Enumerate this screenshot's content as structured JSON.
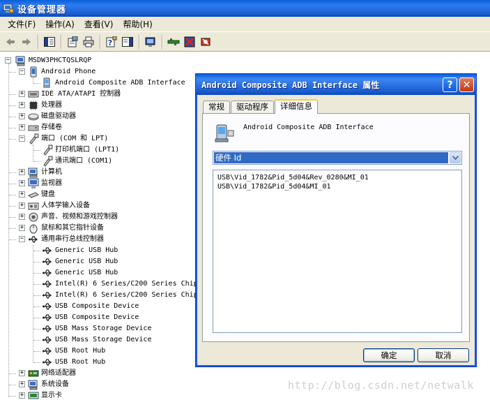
{
  "window": {
    "title": "设备管理器"
  },
  "menu": [
    {
      "label": "文件(F)"
    },
    {
      "label": "操作(A)"
    },
    {
      "label": "查看(V)"
    },
    {
      "label": "帮助(H)"
    }
  ],
  "toolbar": {
    "icons": [
      "back-icon",
      "forward-icon",
      "show-hide-console-tree-icon",
      "properties-icon",
      "print-icon",
      "help-icon",
      "action-pane-icon",
      "scan-hardware-icon",
      "update-driver-icon",
      "disable-device-icon",
      "uninstall-device-icon"
    ]
  },
  "tree": {
    "root": "MSDW3PHCTQSLRQP",
    "nodes": [
      {
        "label": "Android Phone",
        "icon": "phone-icon",
        "level": 1,
        "expander": "-"
      },
      {
        "label": "Android Composite ADB Interface",
        "icon": "usb-device-icon",
        "level": 2,
        "expander": ""
      },
      {
        "label": "IDE ATA/ATAPI 控制器",
        "icon": "ide-controller-icon",
        "level": 1,
        "expander": "+"
      },
      {
        "label": "处理器",
        "icon": "processor-icon",
        "level": 1,
        "expander": "+"
      },
      {
        "label": "磁盘驱动器",
        "icon": "disk-drive-icon",
        "level": 1,
        "expander": "+"
      },
      {
        "label": "存储卷",
        "icon": "storage-volume-icon",
        "level": 1,
        "expander": "+"
      },
      {
        "label": "端口 (COM 和 LPT)",
        "icon": "port-icon",
        "level": 1,
        "expander": "-"
      },
      {
        "label": "打印机端口 (LPT1)",
        "icon": "port-icon",
        "level": 2,
        "expander": ""
      },
      {
        "label": "通讯端口 (COM1)",
        "icon": "port-icon",
        "level": 2,
        "expander": ""
      },
      {
        "label": "计算机",
        "icon": "computer-icon",
        "level": 1,
        "expander": "+"
      },
      {
        "label": "监视器",
        "icon": "monitor-icon",
        "level": 1,
        "expander": "+"
      },
      {
        "label": "键盘",
        "icon": "keyboard-icon",
        "level": 1,
        "expander": "+"
      },
      {
        "label": "人体学输入设备",
        "icon": "hid-icon",
        "level": 1,
        "expander": "+"
      },
      {
        "label": "声音、视频和游戏控制器",
        "icon": "sound-icon",
        "level": 1,
        "expander": "+"
      },
      {
        "label": "鼠标和其它指针设备",
        "icon": "mouse-icon",
        "level": 1,
        "expander": "+"
      },
      {
        "label": "通用串行总线控制器",
        "icon": "usb-icon",
        "level": 1,
        "expander": "-"
      },
      {
        "label": "Generic USB Hub",
        "icon": "usb-icon",
        "level": 2,
        "expander": ""
      },
      {
        "label": "Generic USB Hub",
        "icon": "usb-icon",
        "level": 2,
        "expander": ""
      },
      {
        "label": "Generic USB Hub",
        "icon": "usb-icon",
        "level": 2,
        "expander": ""
      },
      {
        "label": "Intel(R) 6 Series/C200 Series Chip",
        "icon": "usb-icon",
        "level": 2,
        "expander": ""
      },
      {
        "label": "Intel(R) 6 Series/C200 Series Chip",
        "icon": "usb-icon",
        "level": 2,
        "expander": ""
      },
      {
        "label": "USB Composite Device",
        "icon": "usb-icon",
        "level": 2,
        "expander": ""
      },
      {
        "label": "USB Composite Device",
        "icon": "usb-icon",
        "level": 2,
        "expander": ""
      },
      {
        "label": "USB Mass Storage Device",
        "icon": "usb-icon",
        "level": 2,
        "expander": ""
      },
      {
        "label": "USB Mass Storage Device",
        "icon": "usb-icon",
        "level": 2,
        "expander": ""
      },
      {
        "label": "USB Root Hub",
        "icon": "usb-icon",
        "level": 2,
        "expander": ""
      },
      {
        "label": "USB Root Hub",
        "icon": "usb-icon",
        "level": 2,
        "expander": ""
      },
      {
        "label": "网络适配器",
        "icon": "network-adapter-icon",
        "level": 1,
        "expander": "+"
      },
      {
        "label": "系统设备",
        "icon": "computer-icon",
        "level": 1,
        "expander": "+"
      },
      {
        "label": "显示卡",
        "icon": "display-adapter-icon",
        "level": 1,
        "expander": "+"
      }
    ]
  },
  "dialog": {
    "title": "Android Composite ADB Interface 属性",
    "help_label": "?",
    "close_label": "✕",
    "tabs": [
      {
        "label": "常规",
        "active": false
      },
      {
        "label": "驱动程序",
        "active": false
      },
      {
        "label": "详细信息",
        "active": true
      }
    ],
    "device_name": "Android Composite ADB Interface",
    "property_select": "硬件 Id",
    "values": [
      "USB\\Vid_1782&Pid_5d04&Rev_0280&MI_01",
      "USB\\Vid_1782&Pid_5d04&MI_01"
    ],
    "ok_label": "确定",
    "cancel_label": "取消"
  },
  "watermark": "http://blog.csdn.net/netwalk"
}
